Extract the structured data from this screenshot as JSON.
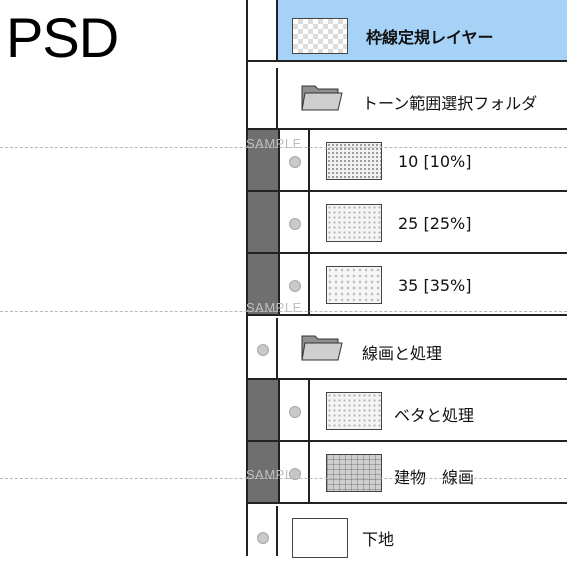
{
  "side_label": "PSD",
  "watermark": "SAMPLE",
  "layers": {
    "top": {
      "name": "枠線定規レイヤー",
      "thumbnail": "transparent-checker"
    },
    "tone_folder": {
      "name": "トーン範囲選択フォルダ",
      "icon": "folder-icon"
    },
    "tone_10": {
      "name": "10 [10%]",
      "thumbnail": "tone"
    },
    "tone_25": {
      "name": "25 [25%]",
      "thumbnail": "tone"
    },
    "tone_35": {
      "name": "35 [35%]",
      "thumbnail": "tone"
    },
    "line_folder": {
      "name": "線画と処理",
      "icon": "folder-icon"
    },
    "fill": {
      "name": "ベタと処理",
      "thumbnail": "tone"
    },
    "building": {
      "name": "建物　線画",
      "thumbnail": "lineart"
    },
    "base": {
      "name": "下地",
      "thumbnail": "blank"
    }
  },
  "colors": {
    "selected_row": "#a6d2f7",
    "clip_bar": "#6f6f6f",
    "border": "#222222"
  }
}
